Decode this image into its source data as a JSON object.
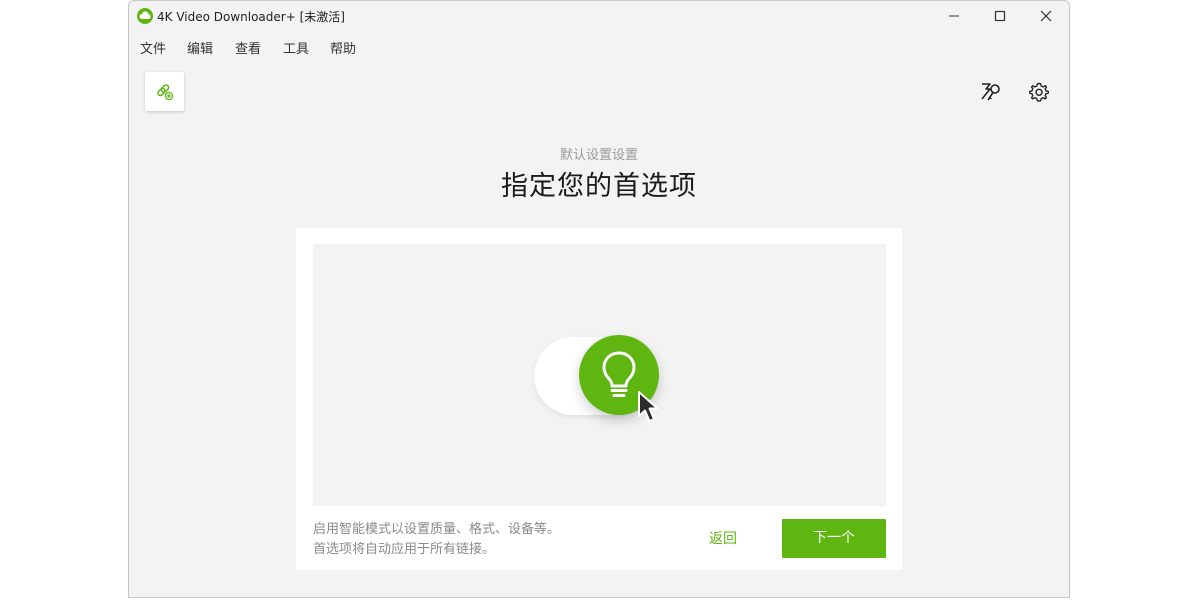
{
  "window": {
    "title": "4K Video Downloader+ [未激活]",
    "controls": [
      "minimize-icon",
      "maximize-icon",
      "close-icon"
    ]
  },
  "menu": {
    "items": [
      "文件",
      "编辑",
      "查看",
      "工具",
      "帮助"
    ]
  },
  "toolbar": {
    "add_link_icon": "link-plus-icon",
    "smart_mode_icon": "smart-mode-icon",
    "settings_icon": "gear-icon"
  },
  "setup": {
    "subtitle": "默认设置设置",
    "heading": "指定您的首选项",
    "description_lines": [
      "启用智能模式以设置质量、格式、设备等。",
      "首选项将自动应用于所有链接。"
    ],
    "back_label": "返回",
    "next_label": "下一个"
  },
  "colors": {
    "accent": "#5fb611",
    "window_bg": "#f3f3f3",
    "card_bg": "#ffffff"
  }
}
